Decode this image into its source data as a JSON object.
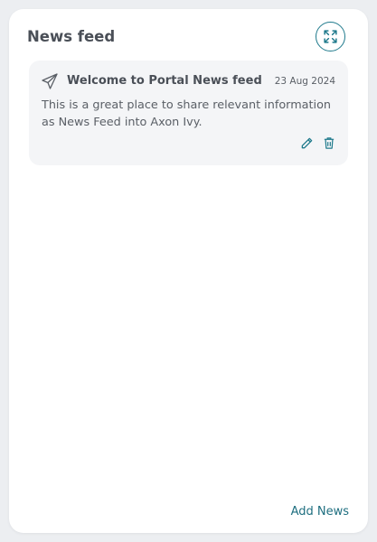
{
  "widget": {
    "title": "News feed",
    "expand_icon": "expand-icon",
    "add_label": "Add News"
  },
  "news_items": [
    {
      "icon": "paper-plane-icon",
      "title": "Welcome to Portal News feed",
      "date": "23 Aug 2024",
      "body": "This is a great place to share relevant information as News Feed into Axon Ivy.",
      "edit_icon": "pencil-icon",
      "delete_icon": "trash-icon"
    }
  ],
  "colors": {
    "accent": "#1f7a8c",
    "card_bg": "#f4f5f7",
    "page_bg": "#eceef1",
    "text": "#4a4f57"
  }
}
